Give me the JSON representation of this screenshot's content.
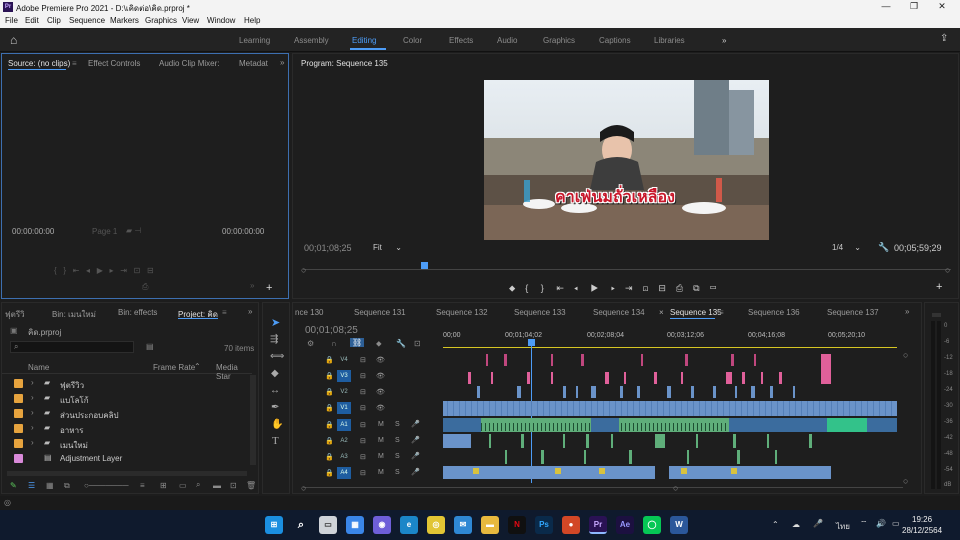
{
  "window": {
    "title": "Adobe Premiere Pro 2021 - D:\\เคิดต่อ\\คิด.prproj *",
    "app_badge": "Pr"
  },
  "menu": [
    "File",
    "Edit",
    "Clip",
    "Sequence",
    "Markers",
    "Graphics",
    "View",
    "Window",
    "Help"
  ],
  "workspaces": [
    "Learning",
    "Assembly",
    "Editing",
    "Color",
    "Effects",
    "Audio",
    "Graphics",
    "Captions",
    "Libraries"
  ],
  "active_workspace": "Editing",
  "source": {
    "tabs": [
      "Source: (no clips)",
      "Effect Controls",
      "Audio Clip Mixer:",
      "Metadat"
    ],
    "timecode_left": "00:00:00:00",
    "page_label": "Page 1",
    "timecode_right": "00:00:00:00"
  },
  "program": {
    "tab": "Program: Sequence 135",
    "timecode": "00;01;08;25",
    "fit": "Fit",
    "ratio": "1/4",
    "duration": "00;05;59;29",
    "caption": "คาเฟ่นมถั่วเหลือง"
  },
  "project": {
    "tabs": [
      "ฟุตรีวิ",
      "Bin: เมนใหม่",
      "Bin: effects",
      "Project: คิด"
    ],
    "file": "คิด.prproj",
    "items_count": "70 items",
    "col_name": "Name",
    "col_rate": "Frame Rate",
    "col_media": "Media Star",
    "folders": [
      "ฟุตรีวิว",
      "แบโลโก้",
      "ส่วนประกอบคลิป",
      "อาหาร",
      "เมนใหม่"
    ],
    "adjustment": "Adjustment Layer",
    "colors": {
      "folder": "#e6a33e",
      "adjustment": "#d98ad9"
    }
  },
  "timeline": {
    "tabs": [
      "nce 130",
      "Sequence 131",
      "Sequence 132",
      "Sequence 133",
      "Sequence 134",
      "Sequence 135",
      "Sequence 136",
      "Sequence 137"
    ],
    "timecode": "00;01;08;25",
    "ruler": [
      "00;00",
      "00;01;04;02",
      "00;02;08;04",
      "00;03;12;06",
      "00;04;16;08",
      "00;05;20;10"
    ],
    "video_tracks": [
      "V4",
      "V3",
      "V2",
      "V1"
    ],
    "audio_tracks": [
      "A1",
      "A2",
      "A3",
      "A4"
    ],
    "mute": "M",
    "solo": "S"
  },
  "meter_ticks": [
    "0",
    "-6",
    "-12",
    "-18",
    "-24",
    "-30",
    "-36",
    "-42",
    "-48",
    "-54",
    "dB"
  ],
  "taskbar": {
    "lang": "ไทย",
    "time": "19:26",
    "date": "28/12/2564",
    "apps": [
      "Ps",
      "Pr",
      "Ae",
      "W"
    ]
  }
}
